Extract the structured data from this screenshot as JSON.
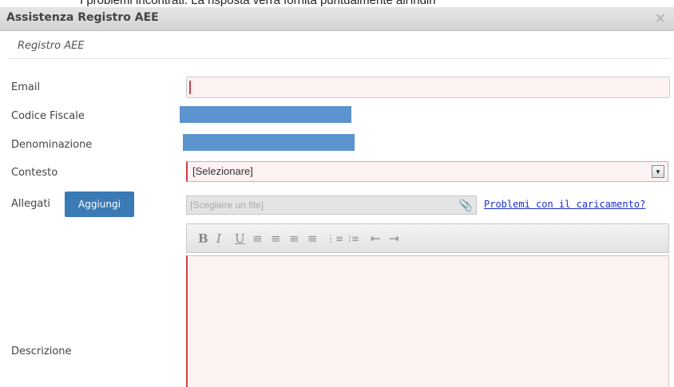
{
  "background_text": "I problemi incontrati. La risposta verrà fornita puntualmente all'indiri",
  "dialog": {
    "title": "Assistenza Registro AEE",
    "close_glyph": "×",
    "subtitle": "Registro AEE"
  },
  "form": {
    "email_label": "Email",
    "codice_fiscale_label": "Codice Fiscale",
    "denominazione_label": "Denominazione",
    "contesto_label": "Contesto",
    "contesto_value": "[Selezionare]",
    "allegati_label": "Allegati",
    "aggiungi_button": "Aggiungi",
    "file_placeholder": "[Scegliere un file]",
    "upload_problem_link": "Problemi con il caricamento?",
    "descrizione_label": "Descrizione"
  },
  "toolbar": {
    "bold": "B",
    "italic": "I",
    "underline": "U",
    "align_left": "≡",
    "align_center": "≡",
    "align_right": "≡",
    "justify": "≡",
    "ordered_list": "⋮≡",
    "unordered_list": "⁝≡",
    "outdent": "⇤",
    "indent": "⇥"
  },
  "colors": {
    "masked_field": "#5b93cf",
    "button": "#3a7ab5",
    "required_border": "#d04040",
    "link": "#1a2fcf"
  }
}
